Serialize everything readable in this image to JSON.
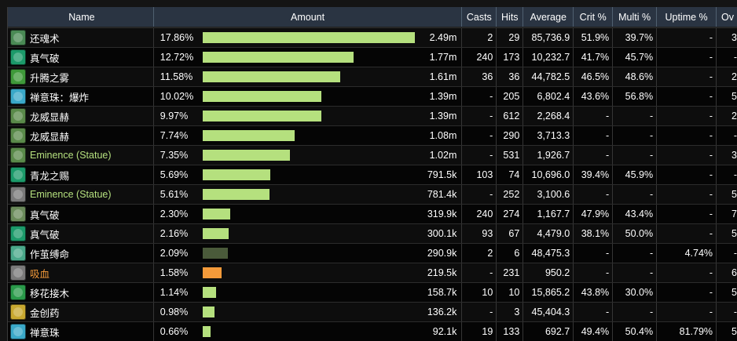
{
  "headers": {
    "name": "Name",
    "amount": "Amount",
    "casts": "Casts",
    "hits": "Hits",
    "average": "Average",
    "crit": "Crit %",
    "multi": "Multi %",
    "uptime": "Uptime %",
    "overflow": "Ov"
  },
  "bar_max_fraction": 0.1786,
  "rows": [
    {
      "name": "还魂术",
      "name_color": "#ffffff",
      "icon": "mist-spell-icon",
      "icon_color": "#4a8a55",
      "pct": "17.86%",
      "pct_value": 17.86,
      "bar_color": "#b5e07e",
      "amount": "2.49m",
      "casts": "2",
      "hits": "29",
      "average": "85,736.9",
      "crit": "51.9%",
      "multi": "39.7%",
      "uptime": "-",
      "ov": "3"
    },
    {
      "name": "真气破",
      "name_color": "#ffffff",
      "icon": "chi-wave-icon",
      "icon_color": "#1c9a6a",
      "pct": "12.72%",
      "pct_value": 12.72,
      "bar_color": "#b5e07e",
      "amount": "1.77m",
      "casts": "240",
      "hits": "173",
      "average": "10,232.7",
      "crit": "41.7%",
      "multi": "45.7%",
      "uptime": "-",
      "ov": "-"
    },
    {
      "name": "升腾之雾",
      "name_color": "#ffffff",
      "icon": "uplift-mist-icon",
      "icon_color": "#3f9a3a",
      "pct": "11.58%",
      "pct_value": 11.58,
      "bar_color": "#b5e07e",
      "amount": "1.61m",
      "casts": "36",
      "hits": "36",
      "average": "44,782.5",
      "crit": "46.5%",
      "multi": "48.6%",
      "uptime": "-",
      "ov": "2"
    },
    {
      "name": "禅意珠：爆炸",
      "name_color": "#ffffff",
      "icon": "zen-sphere-icon",
      "icon_color": "#3aa8c8",
      "pct": "10.02%",
      "pct_value": 10.02,
      "bar_color": "#b5e07e",
      "amount": "1.39m",
      "casts": "-",
      "hits": "205",
      "average": "6,802.4",
      "crit": "43.6%",
      "multi": "56.8%",
      "uptime": "-",
      "ov": "5"
    },
    {
      "name": "龙威显赫",
      "name_color": "#ffffff",
      "icon": "serpent-icon",
      "icon_color": "#5a8a4a",
      "pct": "9.97%",
      "pct_value": 9.97,
      "bar_color": "#b5e07e",
      "amount": "1.39m",
      "casts": "-",
      "hits": "612",
      "average": "2,268.4",
      "crit": "-",
      "multi": "-",
      "uptime": "-",
      "ov": "2"
    },
    {
      "name": "龙威显赫",
      "name_color": "#ffffff",
      "icon": "serpent-icon",
      "icon_color": "#5a8a4a",
      "pct": "7.74%",
      "pct_value": 7.74,
      "bar_color": "#b5e07e",
      "amount": "1.08m",
      "casts": "-",
      "hits": "290",
      "average": "3,713.3",
      "crit": "-",
      "multi": "-",
      "uptime": "-",
      "ov": "-"
    },
    {
      "name": "Eminence (Statue)",
      "name_color": "#b5e07e",
      "icon": "serpent-icon",
      "icon_color": "#5a8a4a",
      "pct": "7.35%",
      "pct_value": 7.35,
      "bar_color": "#b5e07e",
      "amount": "1.02m",
      "casts": "-",
      "hits": "531",
      "average": "1,926.7",
      "crit": "-",
      "multi": "-",
      "uptime": "-",
      "ov": "3"
    },
    {
      "name": "青龙之赐",
      "name_color": "#ffffff",
      "icon": "jade-gift-icon",
      "icon_color": "#1c9a6a",
      "pct": "5.69%",
      "pct_value": 5.69,
      "bar_color": "#b5e07e",
      "amount": "791.5k",
      "casts": "103",
      "hits": "74",
      "average": "10,696.0",
      "crit": "39.4%",
      "multi": "45.9%",
      "uptime": "-",
      "ov": "-"
    },
    {
      "name": "Eminence (Statue)",
      "name_color": "#b5e07e",
      "icon": "sword-icon",
      "icon_color": "#7a7a7a",
      "pct": "5.61%",
      "pct_value": 5.61,
      "bar_color": "#b5e07e",
      "amount": "781.4k",
      "casts": "-",
      "hits": "252",
      "average": "3,100.6",
      "crit": "-",
      "multi": "-",
      "uptime": "-",
      "ov": "5"
    },
    {
      "name": "真气破",
      "name_color": "#ffffff",
      "icon": "chi-burst-icon",
      "icon_color": "#6a8a5a",
      "pct": "2.30%",
      "pct_value": 2.3,
      "bar_color": "#b5e07e",
      "amount": "319.9k",
      "casts": "240",
      "hits": "274",
      "average": "1,167.7",
      "crit": "47.9%",
      "multi": "43.4%",
      "uptime": "-",
      "ov": "7"
    },
    {
      "name": "真气破",
      "name_color": "#ffffff",
      "icon": "chi-wave-icon",
      "icon_color": "#1c9a6a",
      "pct": "2.16%",
      "pct_value": 2.16,
      "bar_color": "#b5e07e",
      "amount": "300.1k",
      "casts": "93",
      "hits": "67",
      "average": "4,479.0",
      "crit": "38.1%",
      "multi": "50.0%",
      "uptime": "-",
      "ov": "5"
    },
    {
      "name": "作茧缚命",
      "name_color": "#ffffff",
      "icon": "cocoon-icon",
      "icon_color": "#4aa88a",
      "pct": "2.09%",
      "pct_value": 2.09,
      "bar_color": "#4a5a3a",
      "amount": "290.9k",
      "casts": "2",
      "hits": "6",
      "average": "48,475.3",
      "crit": "-",
      "multi": "-",
      "uptime": "4.74%",
      "ov": "-"
    },
    {
      "name": "吸血",
      "name_color": "#f39a3a",
      "icon": "leech-icon",
      "icon_color": "#7a7a7a",
      "pct": "1.58%",
      "pct_value": 1.58,
      "bar_color": "#f39a3a",
      "amount": "219.5k",
      "casts": "-",
      "hits": "231",
      "average": "950.2",
      "crit": "-",
      "multi": "-",
      "uptime": "-",
      "ov": "6"
    },
    {
      "name": "移花接木",
      "name_color": "#ffffff",
      "icon": "leaf-icon",
      "icon_color": "#2a9a4a",
      "pct": "1.14%",
      "pct_value": 1.14,
      "bar_color": "#b5e07e",
      "amount": "158.7k",
      "casts": "10",
      "hits": "10",
      "average": "15,865.2",
      "crit": "43.8%",
      "multi": "30.0%",
      "uptime": "-",
      "ov": "5"
    },
    {
      "name": "金创药",
      "name_color": "#ffffff",
      "icon": "potion-icon",
      "icon_color": "#c8a830",
      "pct": "0.98%",
      "pct_value": 0.98,
      "bar_color": "#b5e07e",
      "amount": "136.2k",
      "casts": "-",
      "hits": "3",
      "average": "45,404.3",
      "crit": "-",
      "multi": "-",
      "uptime": "-",
      "ov": "-"
    },
    {
      "name": "禅意珠",
      "name_color": "#ffffff",
      "icon": "zen-sphere-icon",
      "icon_color": "#3aa8c8",
      "pct": "0.66%",
      "pct_value": 0.66,
      "bar_color": "#b5e07e",
      "amount": "92.1k",
      "casts": "19",
      "hits": "133",
      "average": "692.7",
      "crit": "49.4%",
      "multi": "50.4%",
      "uptime": "81.79%",
      "ov": "5"
    }
  ]
}
